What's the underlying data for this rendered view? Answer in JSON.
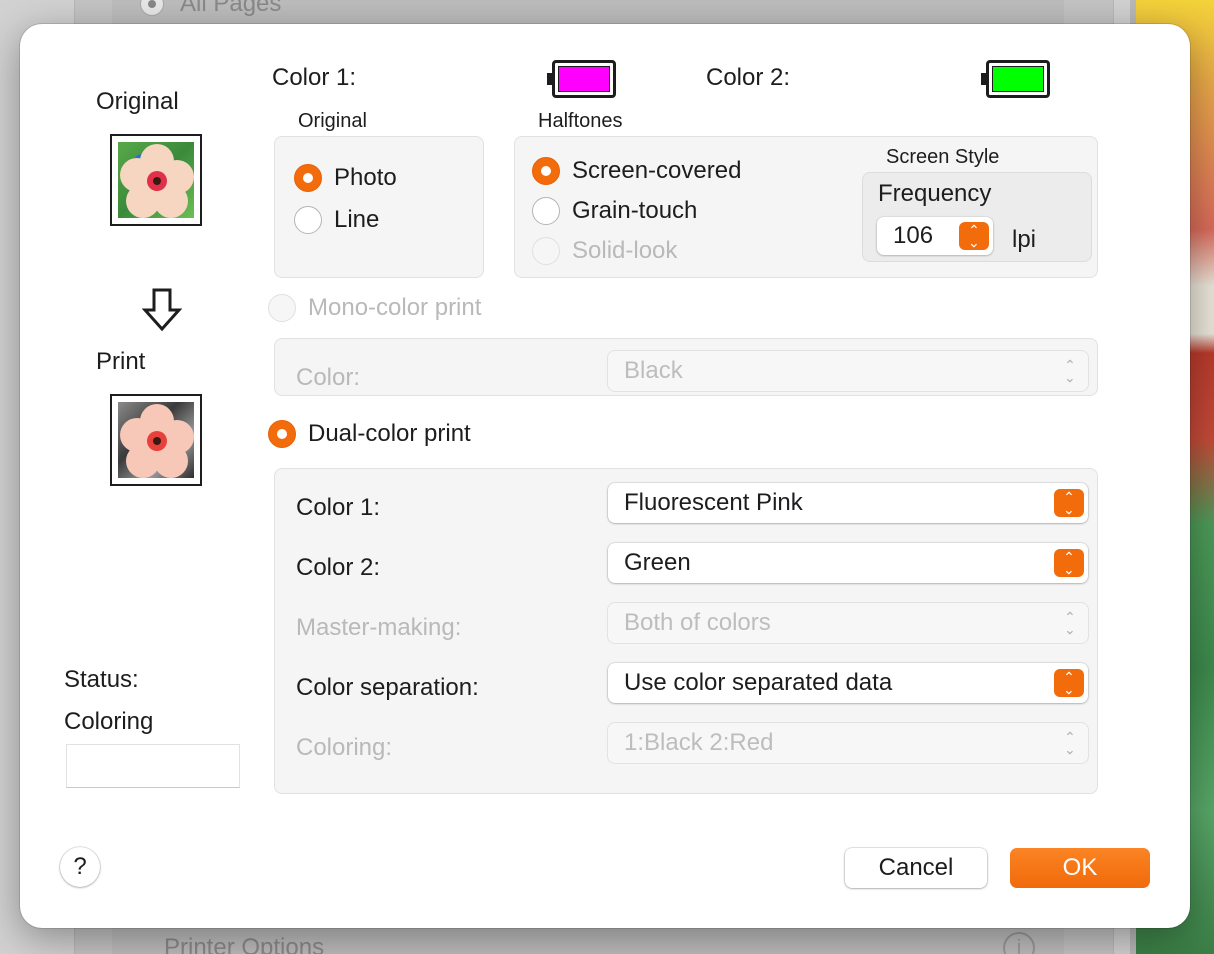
{
  "background": {
    "top_option": "All Pages",
    "bottom_section": "Printer Options",
    "info_icon": "info-icon"
  },
  "preview": {
    "original_label": "Original",
    "print_label": "Print",
    "arrow_icon": "down-arrow-icon"
  },
  "colors": {
    "color1_label": "Color 1:",
    "color1_swatch": "#ff00ff",
    "color2_label": "Color 2:",
    "color2_swatch": "#00ff00"
  },
  "original_group": {
    "title": "Original",
    "options": [
      "Photo",
      "Line"
    ],
    "selected": "Photo"
  },
  "halftones_group": {
    "title": "Halftones",
    "options": [
      "Screen-covered",
      "Grain-touch",
      "Solid-look"
    ],
    "selected": "Screen-covered",
    "disabled": [
      "Solid-look"
    ],
    "screen_style": {
      "title": "Screen Style",
      "frequency_label": "Frequency",
      "frequency_value": "106",
      "unit": "lpi"
    }
  },
  "mono_color": {
    "label": "Mono-color print",
    "enabled": false,
    "color_label": "Color:",
    "color_value": "Black"
  },
  "dual_color": {
    "label": "Dual-color print",
    "selected": true,
    "color1_label": "Color 1:",
    "color1_value": "Fluorescent Pink",
    "color2_label": "Color 2:",
    "color2_value": "Green",
    "master_label": "Master-making:",
    "master_value": "Both of colors",
    "separation_label": "Color separation:",
    "separation_value": "Use color separated data",
    "coloring_label": "Coloring:",
    "coloring_value": "1:Black 2:Red"
  },
  "status": {
    "label": "Status:",
    "value": "Coloring"
  },
  "buttons": {
    "help": "?",
    "cancel": "Cancel",
    "ok": "OK"
  },
  "accent_color": "#f26c0c"
}
